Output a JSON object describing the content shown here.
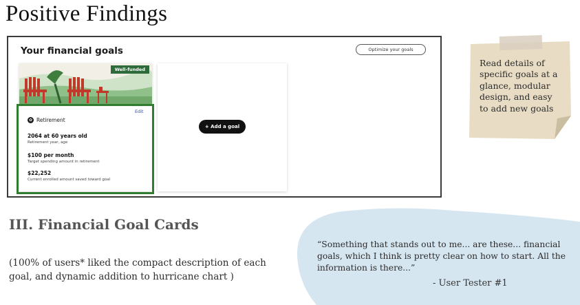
{
  "page": {
    "title": "Positive Findings"
  },
  "ui_screenshot": {
    "header_title": "Your financial goals",
    "optimize_button": "Optimize your goals",
    "goal_card": {
      "badge": "Well-funded",
      "edit_label": "Edit",
      "goal_type": "Retirement",
      "stats": [
        {
          "value": "2064 at 60 years old",
          "label": "Retirement year, age"
        },
        {
          "value": "$100 per month",
          "label": "Target spending amount in retirement"
        },
        {
          "value": "$22,252",
          "label": "Current enrolled amount saved toward goal"
        }
      ]
    },
    "add_goal_button": "+ Add a goal"
  },
  "sticky_note": {
    "text": "Read details of specific goals at a glance, modular design, and easy to add new goals"
  },
  "section": {
    "title": "III. Financial Goal Cards",
    "description": "(100% of users* liked the compact description of each goal, and dynamic addition to hurricane chart )"
  },
  "quote": {
    "text": "“Something that stands out to me... are these... financial goals, which I think is pretty clear on how to start. All the information is there...”",
    "attribution": "- User Tester #1"
  },
  "colors": {
    "highlight_border": "#2f7d2f",
    "badge_bg": "#2f6a3a",
    "sticky_note": "#e8dcc4",
    "quote_blob": "#d6e6f1",
    "edit_link": "#2b4fb0"
  }
}
